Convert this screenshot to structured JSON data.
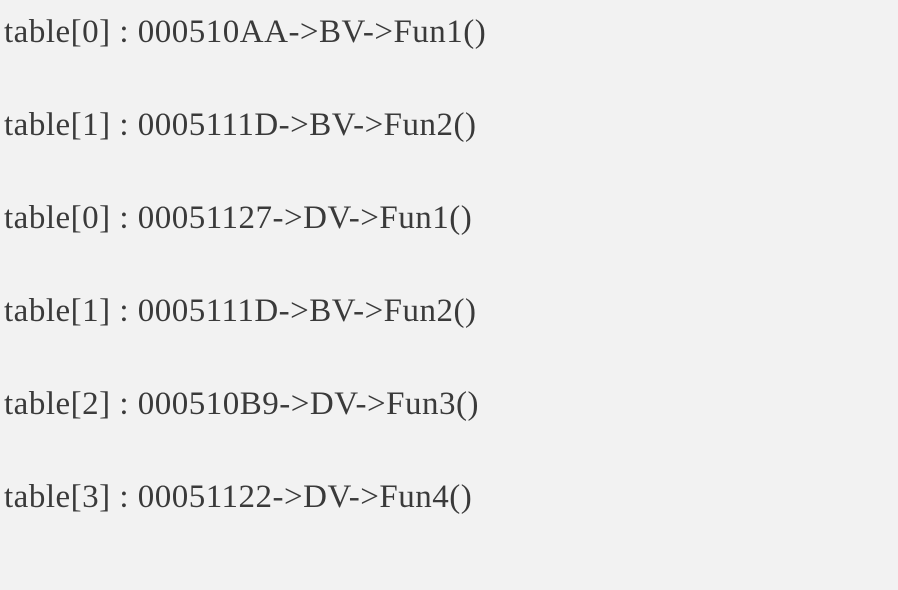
{
  "lines": [
    "table[0] : 000510AA->BV->Fun1()",
    "table[1] : 0005111D->BV->Fun2()",
    "table[0] : 00051127->DV->Fun1()",
    "table[1] : 0005111D->BV->Fun2()",
    "table[2] : 000510B9->DV->Fun3()",
    "table[3] : 00051122->DV->Fun4()"
  ]
}
